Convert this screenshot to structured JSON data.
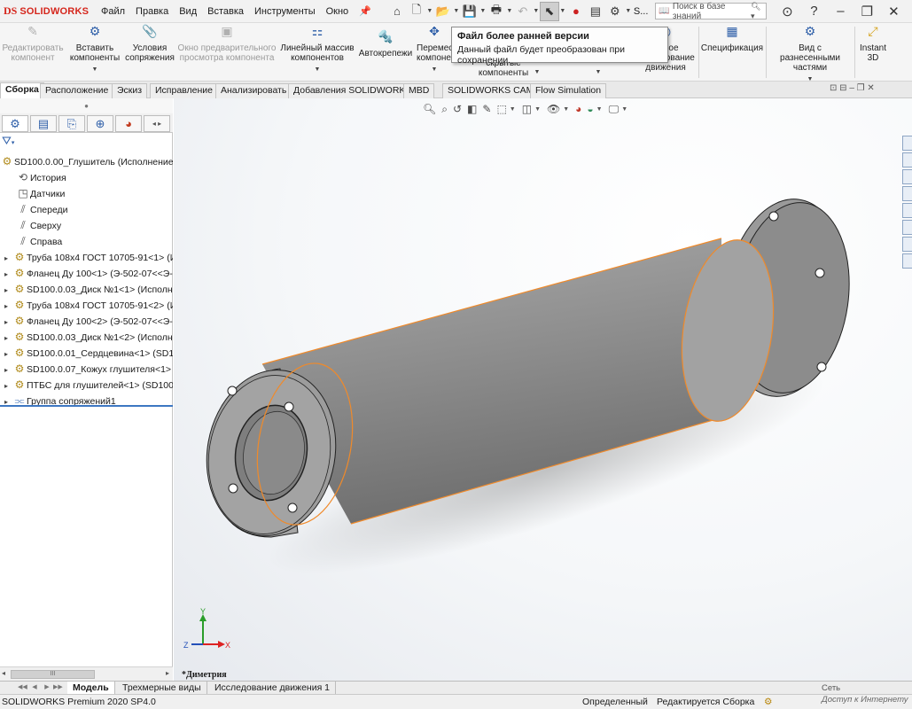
{
  "titlebar": {
    "logo_mark": "DS",
    "brand": "SOLIDWORKS",
    "menu": [
      "Файл",
      "Правка",
      "Вид",
      "Вставка",
      "Инструменты",
      "Окно"
    ],
    "search_placeholder": "Поиск в базе знаний",
    "user_label": "S..."
  },
  "commands": {
    "edit_component": "Редактировать компонент",
    "insert_components": "Вставить компоненты",
    "mates": "Условия сопряжения",
    "preview_window": "Окно предварительного просмотра компонента",
    "linear_pattern": "Линейный массив компонентов",
    "smart_fasteners": "Автокрепежи",
    "move_component": "Переместить компонент",
    "hidden_components": "скрытые компоненты",
    "motion_study": "Новое исследование движения",
    "bom": "Спецификация",
    "exploded_view": "Вид с разнесенными частями",
    "instant3d": "Instant 3D"
  },
  "tooltip": {
    "title": "Файл более ранней версии",
    "text": "Данный файл будет преобразован при сохранении."
  },
  "tabs": [
    "Сборка",
    "Расположение",
    "Эскиз",
    "Исправление",
    "Анализировать",
    "Добавления SOLIDWORKS",
    "MBD",
    "SOLIDWORKS CAM",
    "Flow Simulation"
  ],
  "tree": {
    "root": "SD100.0.00_Глушитель  (Исполнение 1-",
    "items": [
      "История",
      "Датчики",
      "Спереди",
      "Сверху",
      "Справа",
      "Труба 108х4 ГОСТ 10705-91<1> (Ис",
      "Фланец Ду 100<1> (Э-502-07<<Э-5",
      "SD100.0.03_Диск №1<1> (Исполне",
      "Труба 108х4 ГОСТ 10705-91<2> (Ис",
      "Фланец Ду 100<2> (Э-502-07<<Э-5",
      "SD100.0.03_Диск №1<2> (Исполне",
      "SD100.0.01_Сердцевина<1> (SD100.",
      "SD100.0.07_Кожух глушителя<1> (",
      "ПТБС  для глушителей<1> (SD100-",
      "Группа сопряжений1"
    ]
  },
  "viewport": {
    "view_name": "*Диметрия",
    "axis_x": "X",
    "axis_y": "Y",
    "axis_z": "Z"
  },
  "bottom_tabs": [
    "Модель",
    "Трехмерные виды",
    "Исследование движения 1"
  ],
  "statusbar": {
    "product": "SOLIDWORKS Premium 2020 SP4.0",
    "defined": "Определенный",
    "editing": "Редактируется Сборка",
    "net": "Сеть",
    "access": "Доступ к Интернету"
  },
  "colors": {
    "brand": "#d5261c",
    "selection_edge": "#f08a2a",
    "part_gray": "#8e8e8e"
  }
}
